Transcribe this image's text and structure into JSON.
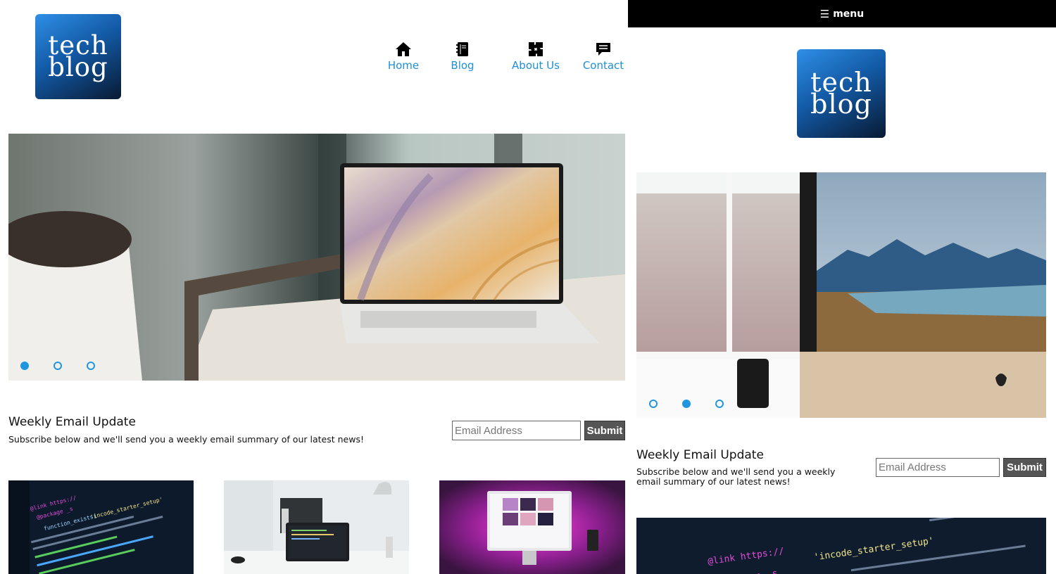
{
  "logo": {
    "line1": "tech",
    "line2": "blog"
  },
  "nav": [
    {
      "label": "Home",
      "icon": "home-icon"
    },
    {
      "label": "Blog",
      "icon": "notebook-icon"
    },
    {
      "label": "About Us",
      "icon": "puzzle-icon"
    },
    {
      "label": "Contact",
      "icon": "chat-icon"
    }
  ],
  "mobile_menu": {
    "label": "menu",
    "icon": "hamburger-icon"
  },
  "slider_desktop": {
    "slides": 3,
    "active": 1
  },
  "slider_mobile": {
    "slides": 3,
    "active": 2
  },
  "newsletter": {
    "title": "Weekly Email Update",
    "description": "Subscribe below and we'll send you a weekly email summary of our latest news!",
    "mobile_line1": "Subscribe below and we'll send you a weekly",
    "mobile_line2": "email summary of our latest news!",
    "placeholder": "Email Address",
    "submit_label": "Submit"
  },
  "thumbs": {
    "code_text_1": "@link https://",
    "code_text_2": "@package _s",
    "code_text_3": "'incode_starter_setup'",
    "code_text_4": "function_exists("
  },
  "colors": {
    "accent": "#1e8fd6",
    "logo_top": "#2f8fe6",
    "logo_bottom": "#081a33",
    "menu_bar": "#000000",
    "submit_bg": "#555555"
  }
}
